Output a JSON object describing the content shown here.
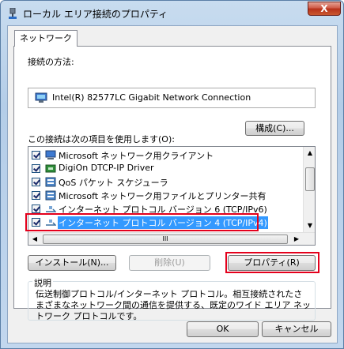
{
  "window": {
    "title": "ローカル エリア接続のプロパティ",
    "close_label": "X",
    "icon": "network-connection-icon"
  },
  "tabs": [
    {
      "label": "ネットワーク",
      "selected": true
    }
  ],
  "connect_using": {
    "label": "接続の方法:",
    "adapter_name": "Intel(R) 82577LC Gigabit Network Connection",
    "configure_button": "構成(C)..."
  },
  "items_section": {
    "label": "この接続は次の項目を使用します(O):",
    "items": [
      {
        "label": "Microsoft ネットワーク用クライアント",
        "checked": true,
        "icon": "client-icon"
      },
      {
        "label": "DigiOn DTCP-IP Driver",
        "checked": true,
        "icon": "driver-icon"
      },
      {
        "label": "QoS パケット スケジューラ",
        "checked": true,
        "icon": "service-icon"
      },
      {
        "label": "Microsoft ネットワーク用ファイルとプリンター共有",
        "checked": true,
        "icon": "service-icon"
      },
      {
        "label": "インターネット プロトコル バージョン 6 (TCP/IPv6)",
        "checked": true,
        "icon": "protocol-icon"
      },
      {
        "label": "インターネット プロトコル バージョン 4 (TCP/IPv4)",
        "checked": true,
        "icon": "protocol-icon",
        "selected": true
      }
    ],
    "hscroll_thumb_label": "III"
  },
  "buttons": {
    "install": "インストール(N)...",
    "uninstall": "削除(U)",
    "properties": "プロパティ(R)",
    "ok": "OK",
    "cancel": "キャンセル"
  },
  "description": {
    "heading": "説明",
    "text": "伝送制御プロトコル/インターネット プロトコル。相互接続されたさまざまなネットワーク間の通信を提供する、既定のワイド エリア ネットワーク プロトコルです。"
  },
  "colors": {
    "highlight_outline": "#e4001c",
    "selection": "#3399ff"
  }
}
